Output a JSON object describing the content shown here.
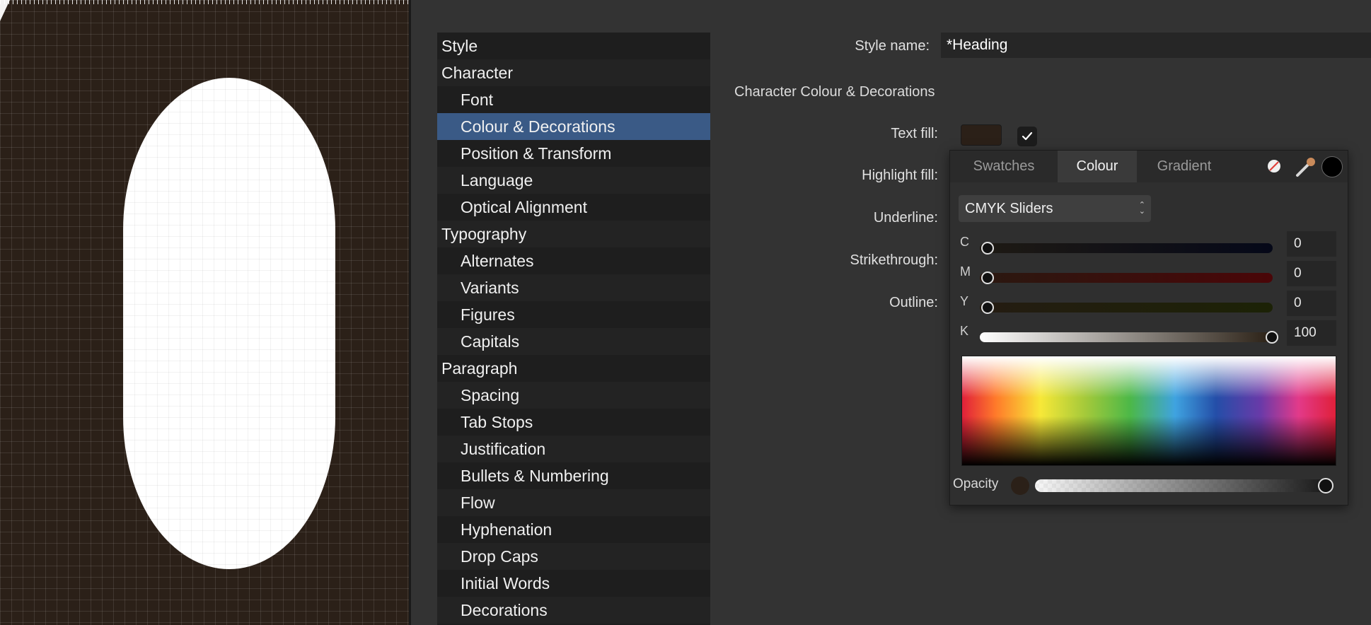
{
  "canvas": {
    "background_color": "#2b2018"
  },
  "category_list": {
    "items": [
      {
        "label": "Style",
        "level": "header"
      },
      {
        "label": "Character",
        "level": "header"
      },
      {
        "label": "Font",
        "level": "sub"
      },
      {
        "label": "Colour & Decorations",
        "level": "sub",
        "selected": true
      },
      {
        "label": "Position & Transform",
        "level": "sub"
      },
      {
        "label": "Language",
        "level": "sub"
      },
      {
        "label": "Optical Alignment",
        "level": "sub"
      },
      {
        "label": "Typography",
        "level": "header"
      },
      {
        "label": "Alternates",
        "level": "sub"
      },
      {
        "label": "Variants",
        "level": "sub"
      },
      {
        "label": "Figures",
        "level": "sub"
      },
      {
        "label": "Capitals",
        "level": "sub"
      },
      {
        "label": "Paragraph",
        "level": "header"
      },
      {
        "label": "Spacing",
        "level": "sub"
      },
      {
        "label": "Tab Stops",
        "level": "sub"
      },
      {
        "label": "Justification",
        "level": "sub"
      },
      {
        "label": "Bullets & Numbering",
        "level": "sub"
      },
      {
        "label": "Flow",
        "level": "sub"
      },
      {
        "label": "Hyphenation",
        "level": "sub"
      },
      {
        "label": "Drop Caps",
        "level": "sub"
      },
      {
        "label": "Initial Words",
        "level": "sub"
      },
      {
        "label": "Decorations",
        "level": "sub"
      }
    ],
    "selected_color": "#3a5a86"
  },
  "form": {
    "style_name_label": "Style name:",
    "style_name_value": "*Heading",
    "section_title": "Character Colour & Decorations",
    "text_fill_label": "Text fill:",
    "text_fill_color": "#2b2018",
    "text_fill_enabled": true,
    "highlight_fill_label": "Highlight fill:",
    "underline_label": "Underline:",
    "strikethrough_label": "Strikethrough:",
    "outline_label": "Outline:"
  },
  "colour_popover": {
    "tabs": [
      "Swatches",
      "Colour",
      "Gradient"
    ],
    "active_tab": "Colour",
    "mode": "CMYK Sliders",
    "sliders": [
      {
        "letter": "C",
        "value": "0"
      },
      {
        "letter": "M",
        "value": "0"
      },
      {
        "letter": "Y",
        "value": "0"
      },
      {
        "letter": "K",
        "value": "100"
      }
    ],
    "opacity_label": "Opacity",
    "opacity": 1.0
  }
}
